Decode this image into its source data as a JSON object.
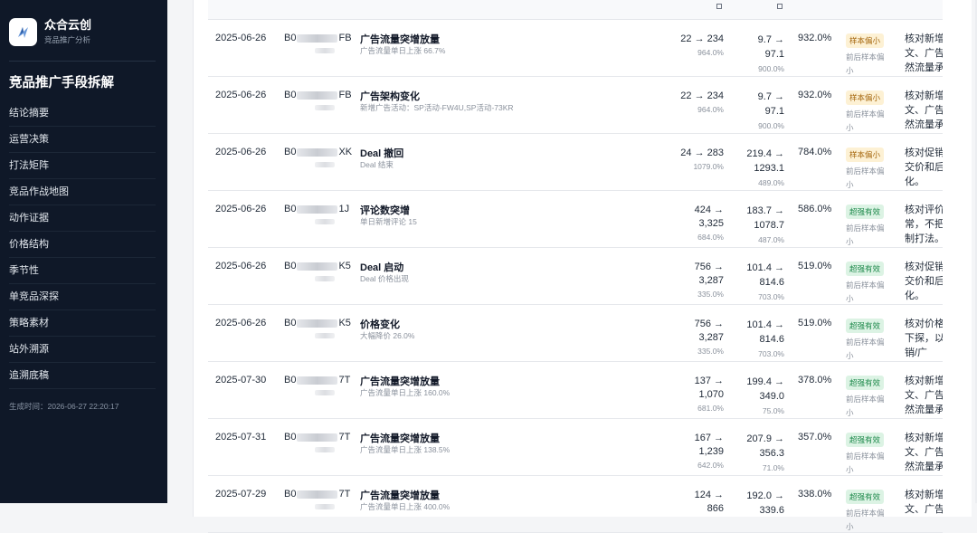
{
  "brand": {
    "name": "众合云创",
    "subtitle": "竞品推广分析",
    "logo_icon": "spark-logo-icon"
  },
  "sidebar": {
    "title": "竞品推广手段拆解",
    "items": [
      {
        "label": "结论摘要"
      },
      {
        "label": "运营决策"
      },
      {
        "label": "打法矩阵"
      },
      {
        "label": "竞品作战地图"
      },
      {
        "label": "动作证据"
      },
      {
        "label": "价格结构"
      },
      {
        "label": "季节性"
      },
      {
        "label": "单竞品深探"
      },
      {
        "label": "策略素材"
      },
      {
        "label": "站外溯源"
      },
      {
        "label": "追溯底稿"
      }
    ],
    "generated": "生成时间：2026-06-27 22:20:17"
  },
  "table": {
    "rows": [
      {
        "date": "2025-06-26",
        "asin_prefix": "B0",
        "asin_suffix": "FB",
        "title": "广告流量突增放量",
        "desc": "广告流量单日上涨 66.7%",
        "v1": "22 → 234",
        "v1_pct": "964.0%",
        "v2a": "9.7 →",
        "v2b": "97.1",
        "v2_pct": "900.0%",
        "total": "932.0%",
        "badge": "样本偏小",
        "badge_type": "warn",
        "note": "前后样本偏小",
        "action": "核对新增文、广告然流量承"
      },
      {
        "date": "2025-06-26",
        "asin_prefix": "B0",
        "asin_suffix": "FB",
        "title": "广告架构变化",
        "desc": "新增广告活动：SP活动-FW4U,SP活动-73KR",
        "v1": "22 → 234",
        "v1_pct": "964.0%",
        "v2a": "9.7 →",
        "v2b": "97.1",
        "v2_pct": "900.0%",
        "total": "932.0%",
        "badge": "样本偏小",
        "badge_type": "warn",
        "note": "前后样本偏小",
        "action": "核对新增文、广告然流量承"
      },
      {
        "date": "2025-06-26",
        "asin_prefix": "B0",
        "asin_suffix": "XK",
        "title": "Deal 撤回",
        "desc": "Deal 结束",
        "v1": "24 → 283",
        "v1_pct": "1079.0%",
        "v2a": "219.4 →",
        "v2b": "1293.1",
        "v2_pct": "489.0%",
        "total": "784.0%",
        "badge": "样本偏小",
        "badge_type": "warn",
        "note": "前后样本偏小",
        "action": "核对促销交价和后化。"
      },
      {
        "date": "2025-06-26",
        "asin_prefix": "B0",
        "asin_suffix": "1J",
        "title": "评论数突增",
        "desc": "单日新增评论 15",
        "v1": "424 →",
        "v1b": "3,325",
        "v1_pct": "684.0%",
        "v2a": "183.7 →",
        "v2b": "1078.7",
        "v2_pct": "487.0%",
        "total": "586.0%",
        "badge": "超强有效",
        "badge_type": "good",
        "note": "前后样本偏小",
        "action": "核对评价常，不把制打法。"
      },
      {
        "date": "2025-06-26",
        "asin_prefix": "B0",
        "asin_suffix": "K5",
        "title": "Deal 启动",
        "desc": "Deal 价格出现",
        "v1": "756 →",
        "v1b": "3,287",
        "v1_pct": "335.0%",
        "v2a": "101.4 →",
        "v2b": "814.6",
        "v2_pct": "703.0%",
        "total": "519.0%",
        "badge": "超强有效",
        "badge_type": "good",
        "note": "前后样本偏小",
        "action": "核对促销交价和后化。"
      },
      {
        "date": "2025-06-26",
        "asin_prefix": "B0",
        "asin_suffix": "K5",
        "title": "价格变化",
        "desc": "大幅降价 26.0%",
        "v1": "756 →",
        "v1b": "3,287",
        "v1_pct": "335.0%",
        "v2a": "101.4 →",
        "v2b": "814.6",
        "v2_pct": "703.0%",
        "total": "519.0%",
        "badge": "超强有效",
        "badge_type": "good",
        "note": "前后样本偏小",
        "action": "核对价格下探，以销/广告。"
      },
      {
        "date": "2025-07-30",
        "asin_prefix": "B0",
        "asin_suffix": "7T",
        "title": "广告流量突增放量",
        "desc": "广告流量单日上涨 160.0%",
        "v1": "137 →",
        "v1b": "1,070",
        "v1_pct": "681.0%",
        "v2a": "199.4 →",
        "v2b": "349.0",
        "v2_pct": "75.0%",
        "total": "378.0%",
        "badge": "超强有效",
        "badge_type": "good",
        "note": "前后样本偏小",
        "action": "核对新增文、广告然流量承"
      },
      {
        "date": "2025-07-31",
        "asin_prefix": "B0",
        "asin_suffix": "7T",
        "title": "广告流量突增放量",
        "desc": "广告流量单日上涨 138.5%",
        "v1": "167 →",
        "v1b": "1,239",
        "v1_pct": "642.0%",
        "v2a": "207.9 →",
        "v2b": "356.3",
        "v2_pct": "71.0%",
        "total": "357.0%",
        "badge": "超强有效",
        "badge_type": "good",
        "note": "前后样本偏小",
        "action": "核对新增文、广告然流量承"
      },
      {
        "date": "2025-07-29",
        "asin_prefix": "B0",
        "asin_suffix": "7T",
        "title": "广告流量突增放量",
        "desc": "广告流量单日上涨 400.0%",
        "v1": "124 →",
        "v1b": "866",
        "v1_pct": "",
        "v2a": "192.0 →",
        "v2b": "339.6",
        "v2_pct": "",
        "total": "338.0%",
        "badge": "超强有效",
        "badge_type": "good",
        "note": "前后样本偏小",
        "action": "核对新增文、广告"
      }
    ]
  }
}
